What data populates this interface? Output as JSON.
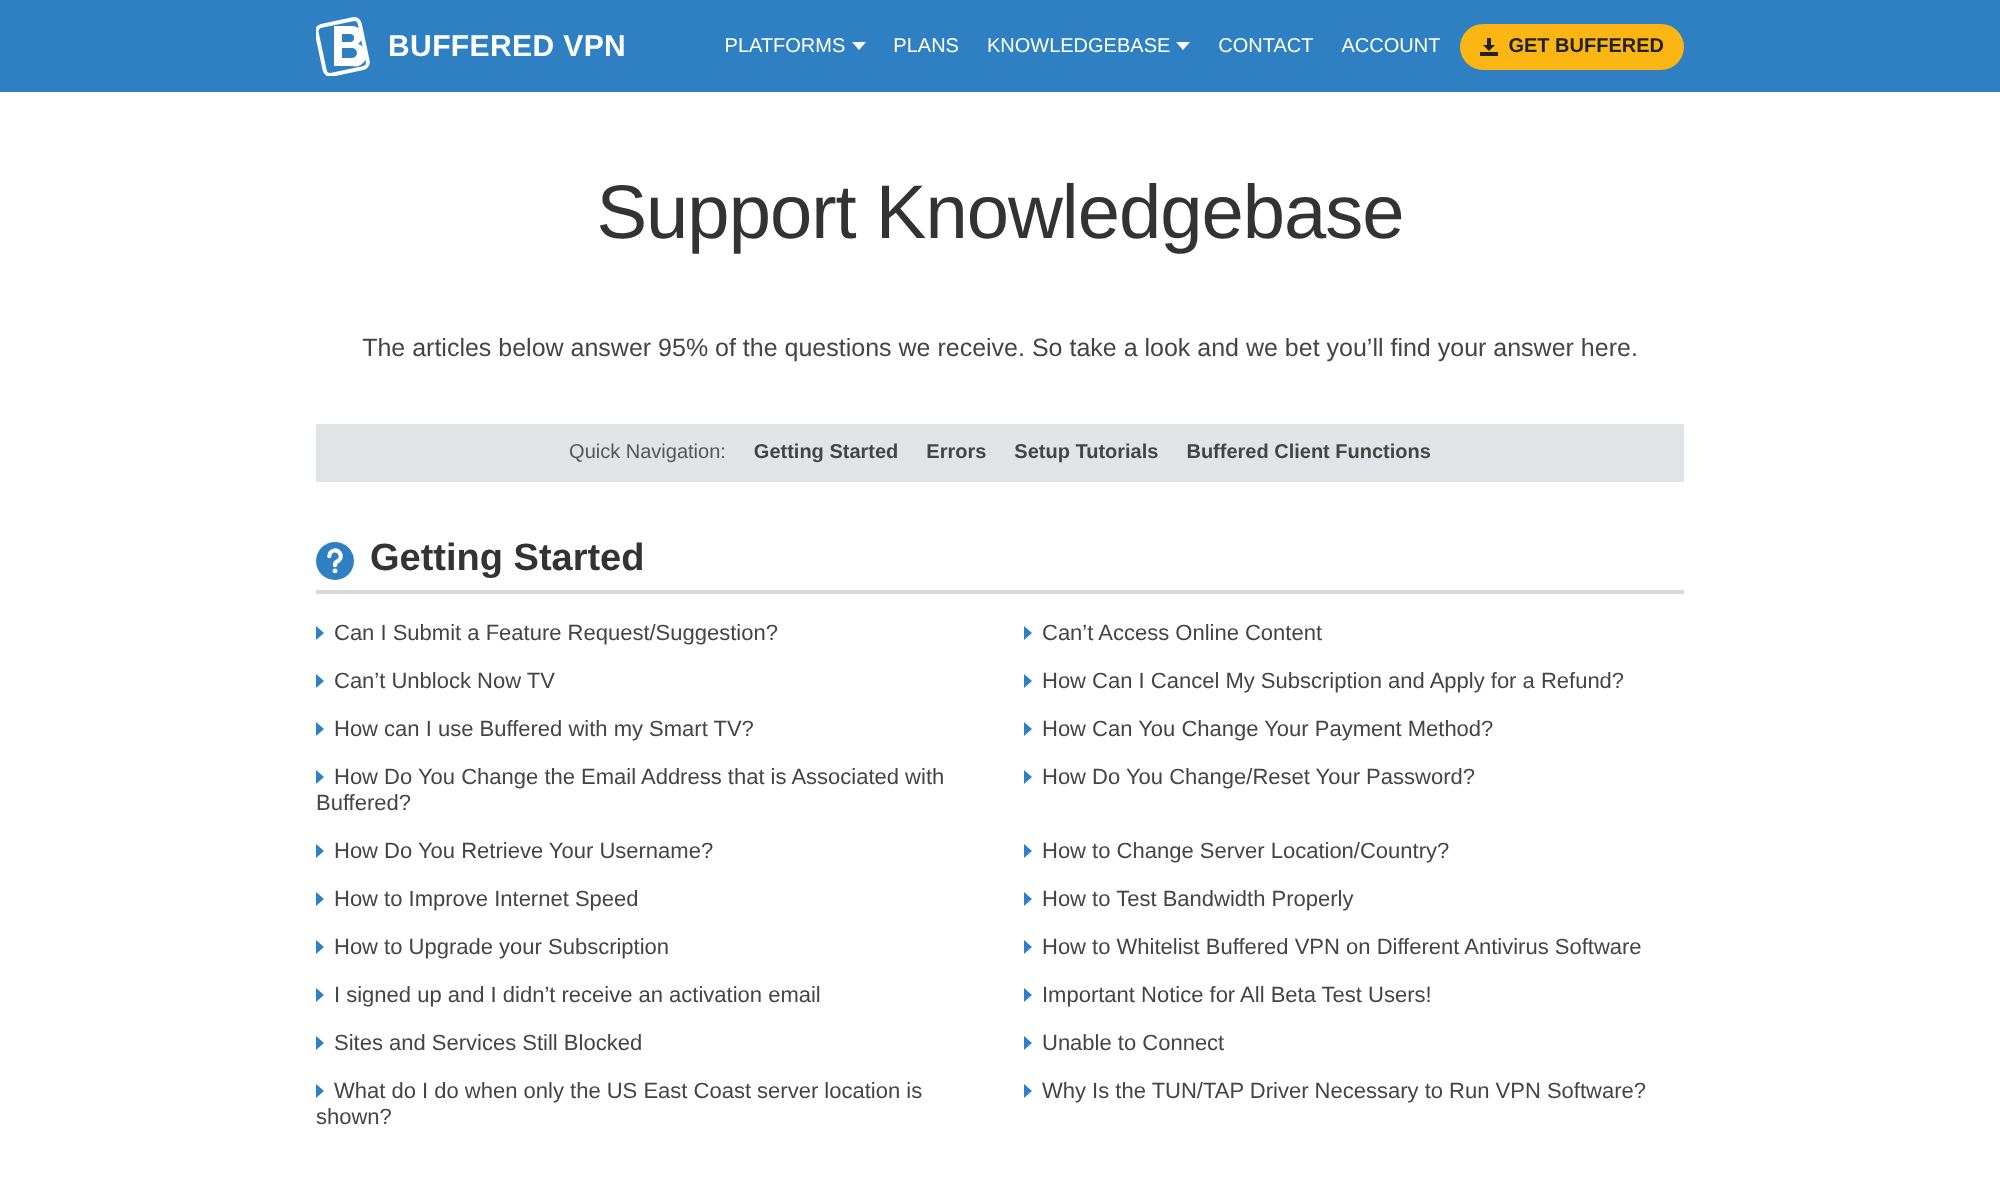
{
  "header": {
    "logo_text": "BUFFERED VPN",
    "nav": [
      {
        "label": "PLATFORMS",
        "kind": "dropdown"
      },
      {
        "label": "PLANS",
        "kind": "link"
      },
      {
        "label": "KNOWLEDGEBASE",
        "kind": "dropdown"
      },
      {
        "label": "CONTACT",
        "kind": "link"
      },
      {
        "label": "ACCOUNT",
        "kind": "link"
      }
    ],
    "cta": "GET BUFFERED"
  },
  "title": "Support Knowledgebase",
  "subtitle": "The articles below answer 95% of the questions we receive. So take a look and we bet you’ll find your answer here.",
  "quick_nav": {
    "label": "Quick Navigation:",
    "links": [
      "Getting Started",
      "Errors",
      "Setup Tutorials",
      "Buffered Client Functions"
    ]
  },
  "section": {
    "heading": "Getting Started",
    "articles": [
      "Can I Submit a Feature Request/Suggestion?",
      "Can’t Access Online Content",
      "Can’t Unblock Now TV",
      "How Can I Cancel My Subscription and Apply for a Refund?",
      "How can I use Buffered with my Smart TV?",
      "How Can You Change Your Payment Method?",
      "How Do You Change the Email Address that is Associated with Buffered?",
      "How Do You Change/Reset Your Password?",
      "How Do You Retrieve Your Username?",
      "How to Change Server Location/Country?",
      "How to Improve Internet Speed",
      "How to Test Bandwidth Properly",
      "How to Upgrade your Subscription",
      "How to Whitelist Buffered VPN on Different Antivirus Software",
      "I signed up and I didn’t receive an activation email",
      "Important Notice for All Beta Test Users!",
      "Sites and Services Still Blocked",
      "Unable to Connect",
      "What do I do when only the US East Coast server location is shown?",
      "Why Is the TUN/TAP Driver Necessary to Run VPN Software?"
    ]
  }
}
